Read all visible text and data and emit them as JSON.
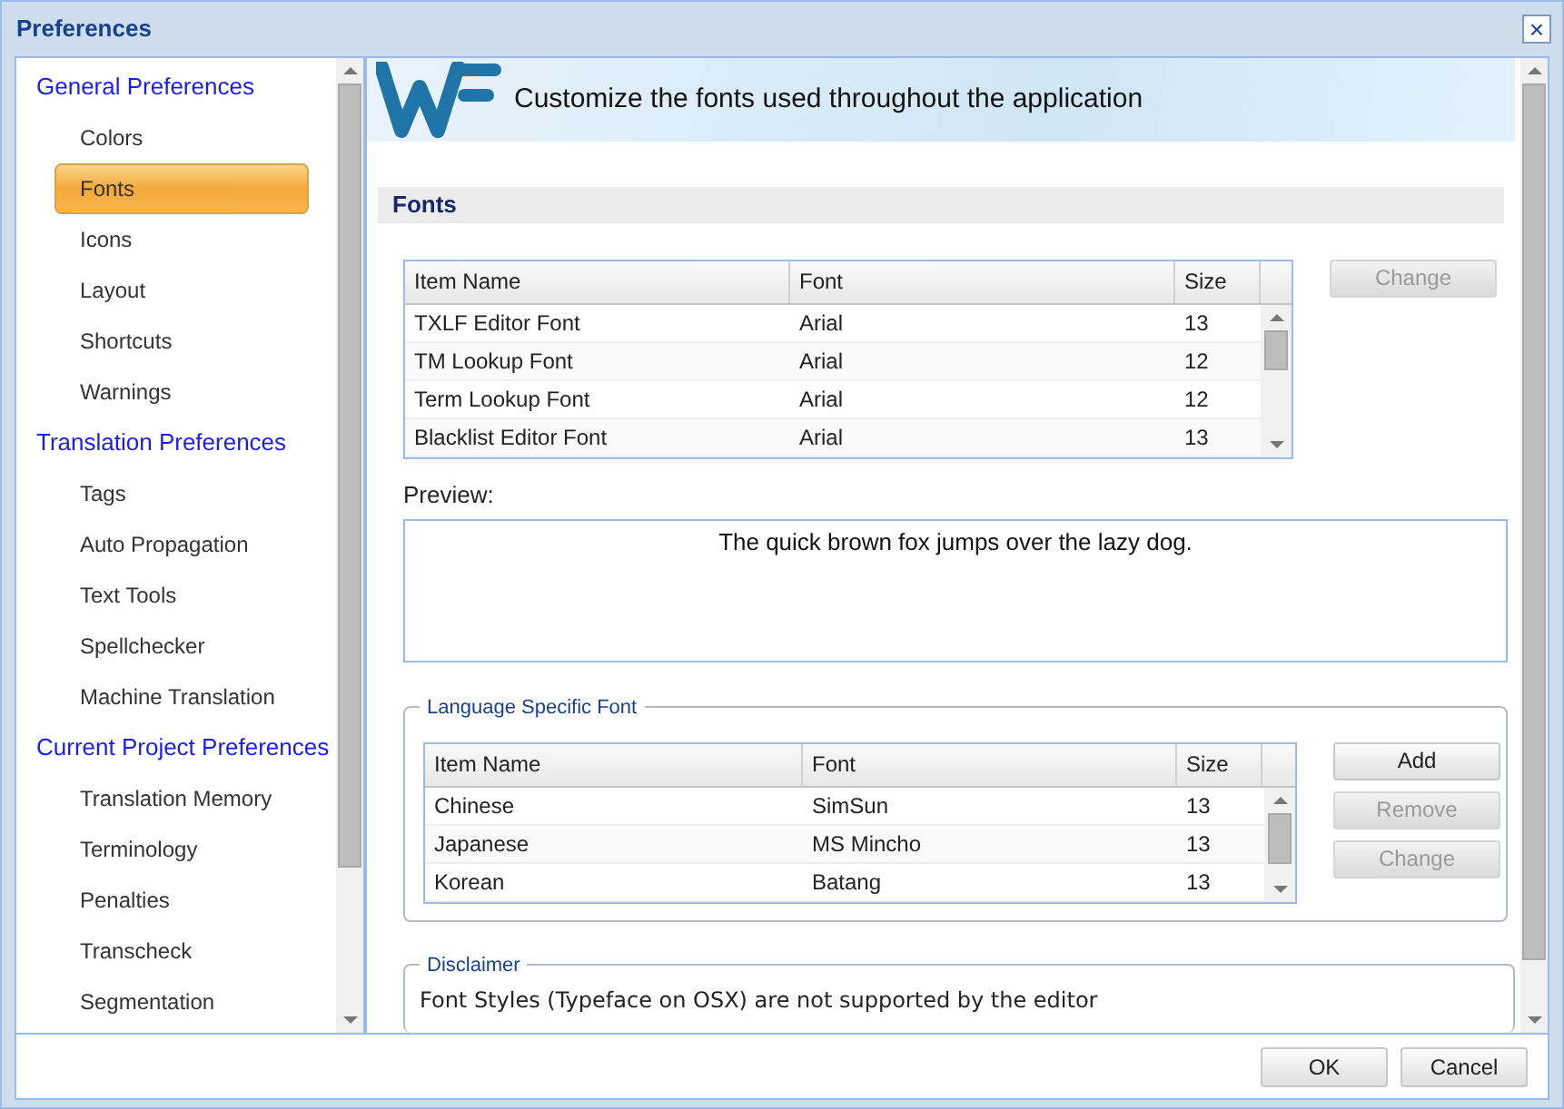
{
  "window": {
    "title": "Preferences",
    "close": "×"
  },
  "sidebar": {
    "groups": [
      {
        "label": "General Preferences",
        "children": [
          {
            "label": "Colors",
            "selected": false
          },
          {
            "label": "Fonts",
            "selected": true
          },
          {
            "label": "Icons",
            "selected": false
          },
          {
            "label": "Layout",
            "selected": false
          },
          {
            "label": "Shortcuts",
            "selected": false
          },
          {
            "label": "Warnings",
            "selected": false
          }
        ]
      },
      {
        "label": "Translation Preferences",
        "children": [
          {
            "label": "Tags",
            "selected": false
          },
          {
            "label": "Auto Propagation",
            "selected": false
          },
          {
            "label": "Text Tools",
            "selected": false
          },
          {
            "label": "Spellchecker",
            "selected": false
          },
          {
            "label": "Machine Translation",
            "selected": false
          }
        ]
      },
      {
        "label": "Current Project Preferences",
        "children": [
          {
            "label": "Translation Memory",
            "selected": false
          },
          {
            "label": "Terminology",
            "selected": false
          },
          {
            "label": "Penalties",
            "selected": false
          },
          {
            "label": "Transcheck",
            "selected": false
          },
          {
            "label": "Segmentation",
            "selected": false
          }
        ]
      }
    ]
  },
  "banner": {
    "text": "Customize the fonts used throughout the application"
  },
  "section": {
    "title": "Fonts"
  },
  "fonts_table": {
    "columns": [
      "Item Name",
      "Font",
      "Size"
    ],
    "rows": [
      [
        "TXLF Editor Font",
        "Arial",
        "13"
      ],
      [
        "TM Lookup Font",
        "Arial",
        "12"
      ],
      [
        "Term Lookup Font",
        "Arial",
        "12"
      ],
      [
        "Blacklist Editor Font",
        "Arial",
        "13"
      ]
    ],
    "buttons": [
      {
        "label": "Change",
        "disabled": true
      }
    ]
  },
  "preview": {
    "label": "Preview:",
    "text": "The quick brown fox jumps over the lazy dog."
  },
  "language_font": {
    "legend": "Language Specific Font",
    "columns": [
      "Item Name",
      "Font",
      "Size"
    ],
    "rows": [
      [
        "Chinese",
        "SimSun",
        "13"
      ],
      [
        "Japanese",
        "MS Mincho",
        "13"
      ],
      [
        "Korean",
        "Batang",
        "13"
      ]
    ],
    "buttons": [
      {
        "label": "Add",
        "disabled": false
      },
      {
        "label": "Remove",
        "disabled": true
      },
      {
        "label": "Change",
        "disabled": true
      }
    ]
  },
  "disclaimer": {
    "legend": "Disclaimer",
    "text": "Font Styles (Typeface on OSX) are not supported by the editor"
  },
  "footer_buttons": [
    {
      "label": "OK",
      "disabled": false
    },
    {
      "label": "Cancel",
      "disabled": false
    }
  ]
}
